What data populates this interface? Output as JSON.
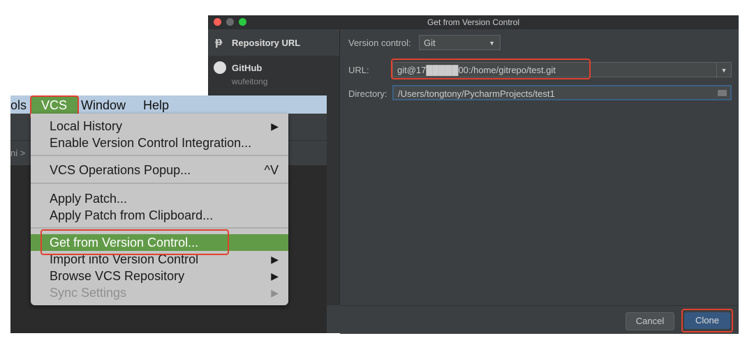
{
  "dialog": {
    "title": "Get from Version Control",
    "sidebar": [
      {
        "label": "Repository URL",
        "icon": "branch-icon"
      },
      {
        "label": "GitHub",
        "sub": "wufeitong",
        "icon": "github-icon"
      }
    ],
    "version_control_label": "Version control:",
    "version_control_value": "Git",
    "url_label": "URL:",
    "url_value": "git@17█████00:/home/gitrepo/test.git",
    "directory_label": "Directory:",
    "directory_value": "/Users/tongtony/PycharmProjects/test1",
    "cancel": "Cancel",
    "clone": "Clone"
  },
  "ide": {
    "menubar": [
      "ols",
      "VCS",
      "Window",
      "Help"
    ],
    "breadcrumb": "ni >",
    "menu": [
      {
        "label": "Local History",
        "arrow": "▶"
      },
      {
        "label": "Enable Version Control Integration..."
      },
      {
        "label": "VCS Operations Popup...",
        "shortcut": "^V"
      },
      {
        "label": "Apply Patch..."
      },
      {
        "label": "Apply Patch from Clipboard..."
      },
      {
        "label": "Get from Version Control..."
      },
      {
        "label": "Import into Version Control",
        "arrow": "▶"
      },
      {
        "label": "Browse VCS Repository",
        "arrow": "▶"
      },
      {
        "label": "Sync Settings",
        "arrow": "▶"
      }
    ]
  },
  "colors": {
    "highlight": "#629b48",
    "annotation": "#e2412e"
  }
}
